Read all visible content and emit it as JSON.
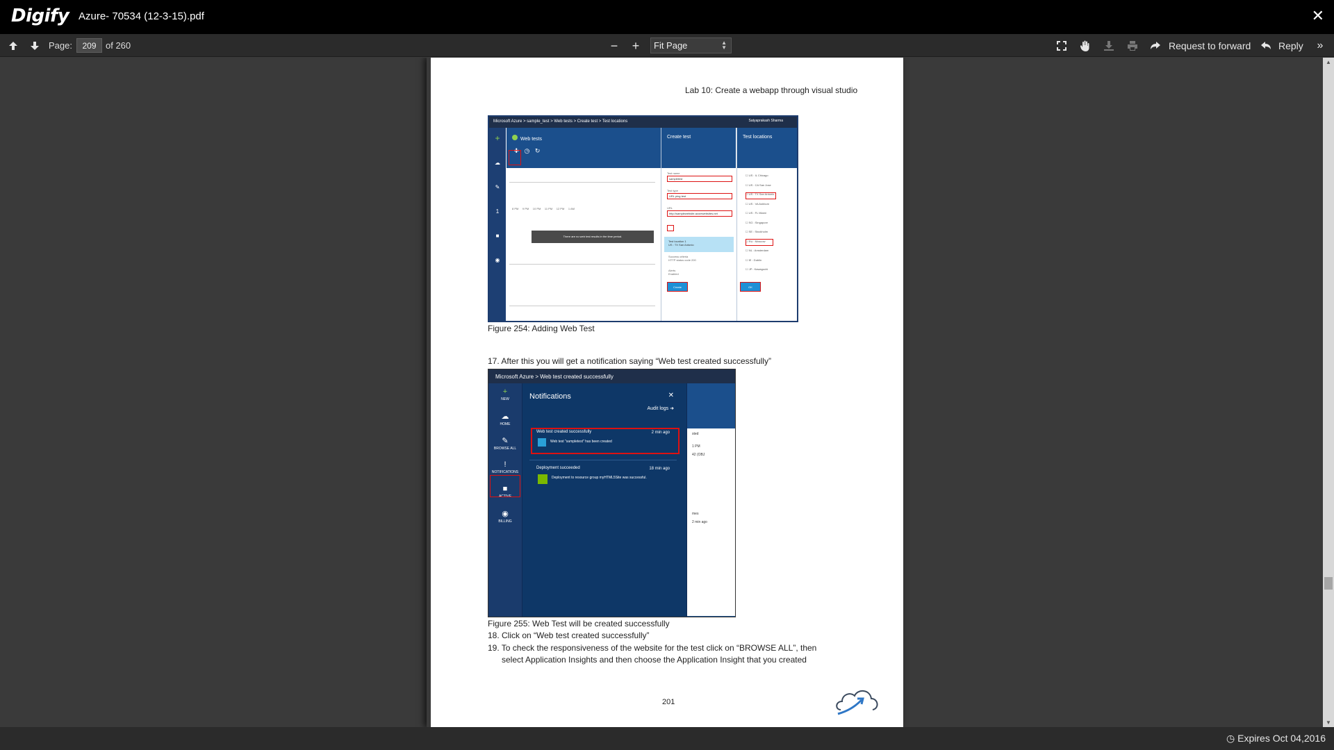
{
  "app": {
    "logo": "Digify",
    "doc_title": "Azure- 70534 (12-3-15).pdf"
  },
  "toolbar": {
    "page_label": "Page:",
    "page_value": "209",
    "page_of": "of 260",
    "zoom_value": "Fit Page",
    "request_forward": "Request to forward",
    "reply": "Reply"
  },
  "status": {
    "expires": "Expires Oct 04,2016"
  },
  "page": {
    "header": "Lab 10: Create a webapp through visual studio",
    "figure1_caption": "Figure 254: Adding Web Test",
    "step17": "17. After this you will get a notification saying “Web test created successfully”",
    "figure2_caption": "Figure 255: Web Test will be created successfully",
    "step18": "18. Click on “Web test created successfully”",
    "step19_line1": "19. To check the responsiveness of the website for the test click on “BROWSE ALL”, then",
    "step19_line2": "select Application Insights and then choose the Application Insight that you created",
    "page_number": "201"
  },
  "screenshot1": {
    "breadcrumb": "Microsoft Azure  >  sample_test  >  Web tests  >  Create test  >  Test locations",
    "user": "Satyaprakash Sharma",
    "web_tests_title": "Web tests",
    "create_test_title": "Create test",
    "test_locations_title": "Test locations",
    "no_results": "There are no web test results in the time period.",
    "test_name_label": "Test name",
    "test_name_value": "sampletest",
    "test_type_label": "Test type",
    "test_type_value": "URL ping test",
    "url_label": "URL",
    "url_value": "http://samplewebsite.azurewebsites.net",
    "test_location_item": "Test location 1",
    "test_location_value": "US : TX San Antonio",
    "success_item": "Success criteria",
    "success_value": "HTTP status code 200",
    "alerts_item": "Alerts",
    "alerts_value": "Enabled",
    "create_button": "Create",
    "ok_button": "OK",
    "locations": [
      "US : IL Chicago",
      "US : CA San Jose",
      "US : TX San Antonio",
      "US : VA Ashburn",
      "US : FL Miami",
      "SG : Singapore",
      "SE : Stockholm",
      "RU : Moscow",
      "NL : Amsterdam",
      "IE : Dublin",
      "JP : Kawaguchi"
    ]
  },
  "screenshot2": {
    "breadcrumb": "Microsoft Azure  >  Web test created successfully",
    "panel_title": "Notifications",
    "audit_logs": "Audit logs",
    "n1_title": "Web test created successfully",
    "n1_time": "2 min ago",
    "n1_body": "Web test \"sampletest\" has been created",
    "n2_title": "Deployment succeeded",
    "n2_time": "18 min ago",
    "n2_body": "Deployment to resource group myHTML5Site was successful.",
    "nav": [
      "NEW",
      "HOME",
      "BROWSE ALL",
      "NOTIFICATIONS",
      "ACTIVE",
      "BILLING"
    ]
  }
}
